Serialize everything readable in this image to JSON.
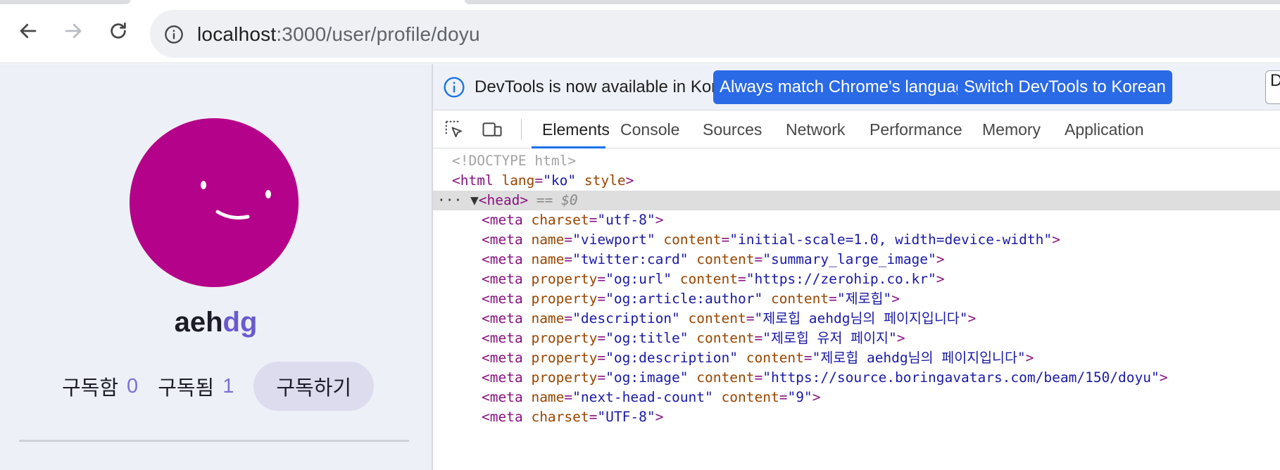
{
  "browser": {
    "url_host": "localhost",
    "url_path": ":3000/user/profile/doyu"
  },
  "profile": {
    "username_dark": "aeh",
    "username_accent": "dg",
    "subscribing_label": "구독함",
    "subscribing_count": "0",
    "subscribed_label": "구독됨",
    "subscribed_count": "1",
    "subscribe_button": "구독하기",
    "avatar_color": "#b5028a",
    "avatar_accent": "#e8a33a"
  },
  "devtools": {
    "infobar_message": "DevTools is now available in Korean!",
    "btn_match_language": "Always match Chrome's language",
    "btn_switch_korean": "Switch DevTools to Korean",
    "btn_extra": "D",
    "tabs": [
      "Elements",
      "Console",
      "Sources",
      "Network",
      "Performance",
      "Memory",
      "Application"
    ],
    "active_tab": "Elements",
    "code": {
      "doctype": "<!DOCTYPE html>",
      "html_open": {
        "tag": "<html",
        "attr1": "lang",
        "val1": "\"ko\"",
        "attr2": "style",
        "close": ">"
      },
      "head_line": {
        "tag": "<head>",
        "suffix": " == $0"
      },
      "meta_lines": [
        {
          "attr1": "charset",
          "val1": "\"utf-8\""
        },
        {
          "attr1": "name",
          "val1": "\"viewport\"",
          "attr2": "content",
          "val2": "\"initial-scale=1.0, width=device-width\""
        },
        {
          "attr1": "name",
          "val1": "\"twitter:card\"",
          "attr2": "content",
          "val2": "\"summary_large_image\""
        },
        {
          "attr1": "property",
          "val1": "\"og:url\"",
          "attr2": "content",
          "val2": "\"https://zerohip.co.kr\""
        },
        {
          "attr1": "property",
          "val1": "\"og:article:author\"",
          "attr2": "content",
          "val2": "\"제로힙\""
        },
        {
          "attr1": "name",
          "val1": "\"description\"",
          "attr2": "content",
          "val2": "\"제로힙 aehdg님의 페이지입니다\""
        },
        {
          "attr1": "property",
          "val1": "\"og:title\"",
          "attr2": "content",
          "val2": "\"제로힙 유저 페이지\""
        },
        {
          "attr1": "property",
          "val1": "\"og:description\"",
          "attr2": "content",
          "val2": "\"제로힙 aehdg님의 페이지입니다\""
        },
        {
          "attr1": "property",
          "val1": "\"og:image\"",
          "attr2": "content",
          "val2": "\"https://source.boringavatars.com/beam/150/doyu\""
        },
        {
          "attr1": "name",
          "val1": "\"next-head-count\"",
          "attr2": "content",
          "val2": "\"9\""
        },
        {
          "attr1": "charset",
          "val1": "\"UTF-8\""
        }
      ]
    }
  }
}
